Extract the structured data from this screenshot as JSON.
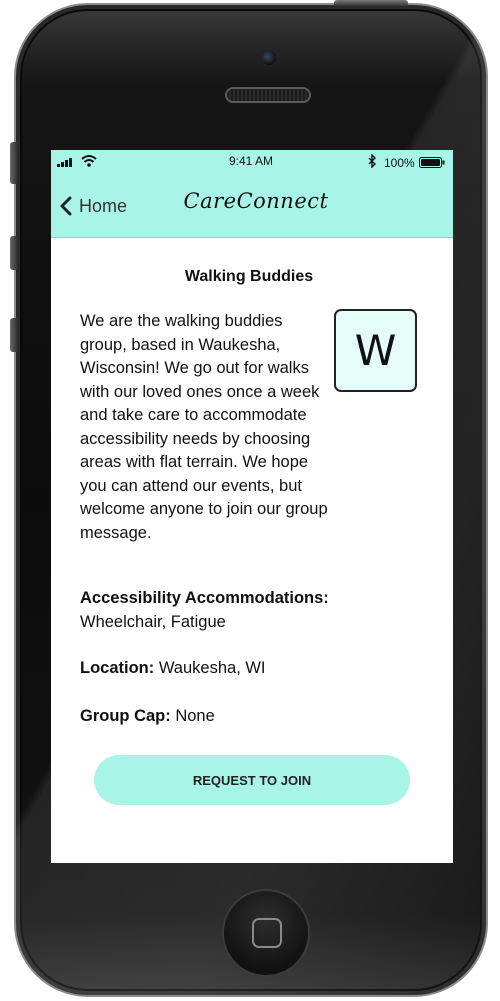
{
  "status_bar": {
    "time": "9:41 AM",
    "battery": "100%"
  },
  "nav": {
    "back_label": "Home",
    "app_title": "CareConnect"
  },
  "group": {
    "title": "Walking Buddies",
    "avatar_letter": "W",
    "description": "We are the walking buddies group, based in Waukesha, Wisconsin! We go out for walks with our loved ones once a week and take care to accommodate accessibility needs by choosing areas with flat terrain. We hope you can attend our events, but welcome anyone to join our group message.",
    "accessibility_label": "Accessibility Accommodations:",
    "accessibility_value": "Wheelchair, Fatigue",
    "location_label": "Location:",
    "location_value": "Waukesha, WI",
    "cap_label": "Group Cap:",
    "cap_value": "None"
  },
  "actions": {
    "join_label": "REQUEST TO JOIN"
  },
  "colors": {
    "accent": "#a8f5e8",
    "avatar_bg": "#e4fdf8"
  }
}
